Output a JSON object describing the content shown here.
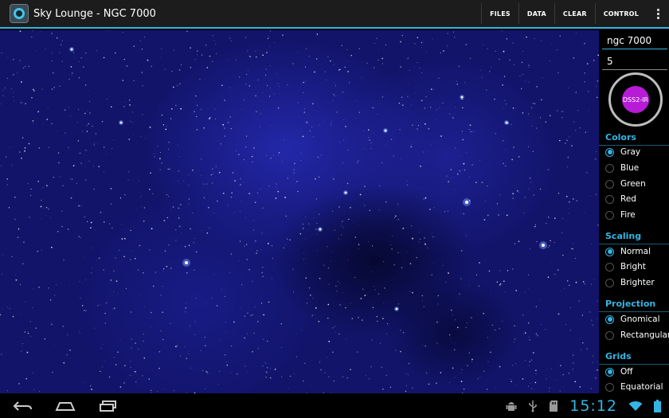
{
  "actionbar": {
    "title": "Sky Lounge - NGC 7000",
    "actions": [
      "FILES",
      "DATA",
      "CLEAR",
      "CONTROL"
    ]
  },
  "panel": {
    "object_value": "ngc 7000",
    "size_value": "5",
    "survey_label": "DSS2-IR",
    "sections": {
      "colors": {
        "title": "Colors",
        "options": [
          "Gray",
          "Blue",
          "Green",
          "Red",
          "Fire"
        ],
        "selected": "Gray"
      },
      "scaling": {
        "title": "Scaling",
        "options": [
          "Normal",
          "Bright",
          "Brighter"
        ],
        "selected": "Normal"
      },
      "projection": {
        "title": "Projection",
        "options": [
          "Gnomical",
          "Rectangular"
        ],
        "selected": "Gnomical"
      },
      "grids": {
        "title": "Grids",
        "options": [
          "Off",
          "Equatorial"
        ],
        "selected": "Off"
      }
    }
  },
  "status": {
    "time": "15:12"
  },
  "colors": {
    "accent": "#33b5e5",
    "survey_button": "#b71bd6",
    "sky": "#12146a"
  },
  "icons": [
    "app-icon",
    "overflow-menu-icon",
    "back-icon",
    "home-icon",
    "recent-apps-icon",
    "android-debug-icon",
    "usb-icon",
    "sd-card-icon",
    "wifi-icon",
    "battery-icon"
  ]
}
